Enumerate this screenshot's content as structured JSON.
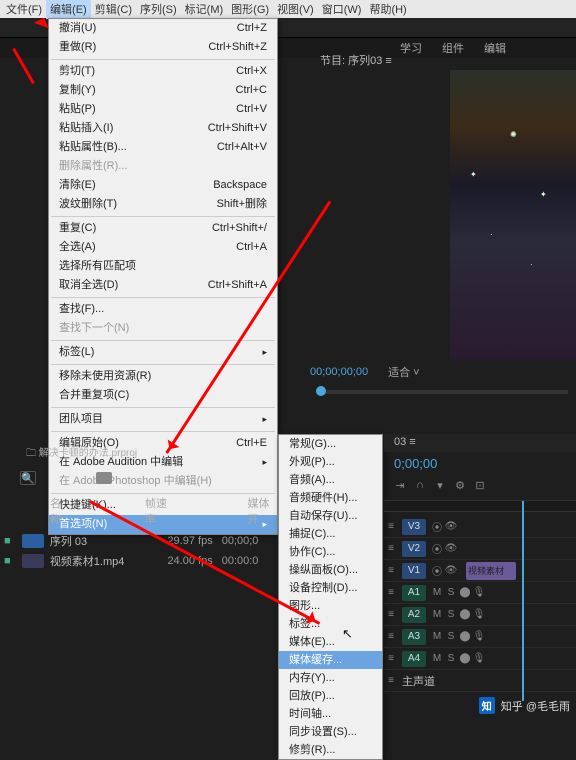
{
  "menubar": [
    "文件(F)",
    "编辑(E)",
    "剪辑(C)",
    "序列(S)",
    "标记(M)",
    "图形(G)",
    "视图(V)",
    "窗口(W)",
    "帮助(H)"
  ],
  "tabs": [
    "学习",
    "组件",
    "编辑"
  ],
  "program_title": "节目: 序列03",
  "edit_menu": [
    {
      "type": "item",
      "label": "撤消(U)",
      "sc": "Ctrl+Z"
    },
    {
      "type": "item",
      "label": "重做(R)",
      "sc": "Ctrl+Shift+Z"
    },
    {
      "type": "sep"
    },
    {
      "type": "item",
      "label": "剪切(T)",
      "sc": "Ctrl+X"
    },
    {
      "type": "item",
      "label": "复制(Y)",
      "sc": "Ctrl+C"
    },
    {
      "type": "item",
      "label": "粘贴(P)",
      "sc": "Ctrl+V"
    },
    {
      "type": "item",
      "label": "粘贴插入(I)",
      "sc": "Ctrl+Shift+V"
    },
    {
      "type": "item",
      "label": "粘贴属性(B)...",
      "sc": "Ctrl+Alt+V"
    },
    {
      "type": "item",
      "label": "删除属性(R)...",
      "sc": "",
      "dis": true
    },
    {
      "type": "item",
      "label": "清除(E)",
      "sc": "Backspace"
    },
    {
      "type": "item",
      "label": "波纹删除(T)",
      "sc": "Shift+删除"
    },
    {
      "type": "sep"
    },
    {
      "type": "item",
      "label": "重复(C)",
      "sc": "Ctrl+Shift+/"
    },
    {
      "type": "item",
      "label": "全选(A)",
      "sc": "Ctrl+A"
    },
    {
      "type": "item",
      "label": "选择所有匹配项",
      "sc": ""
    },
    {
      "type": "item",
      "label": "取消全选(D)",
      "sc": "Ctrl+Shift+A"
    },
    {
      "type": "sep"
    },
    {
      "type": "item",
      "label": "查找(F)...",
      "sc": ""
    },
    {
      "type": "item",
      "label": "查找下一个(N)",
      "sc": "",
      "dis": true
    },
    {
      "type": "sep"
    },
    {
      "type": "item",
      "label": "标签(L)",
      "sc": "",
      "arrow": true
    },
    {
      "type": "sep"
    },
    {
      "type": "item",
      "label": "移除未使用资源(R)",
      "sc": ""
    },
    {
      "type": "item",
      "label": "合并重复项(C)",
      "sc": ""
    },
    {
      "type": "sep"
    },
    {
      "type": "item",
      "label": "团队项目",
      "sc": "",
      "arrow": true
    },
    {
      "type": "sep"
    },
    {
      "type": "item",
      "label": "编辑原始(O)",
      "sc": "Ctrl+E"
    },
    {
      "type": "item",
      "label": "在 Adobe Audition 中编辑",
      "sc": "",
      "arrow": true
    },
    {
      "type": "item",
      "label": "在 Adobe Photoshop 中编辑(H)",
      "sc": "",
      "dis": true
    },
    {
      "type": "sep"
    },
    {
      "type": "item",
      "label": "快捷键(K)...",
      "sc": ""
    },
    {
      "type": "item",
      "label": "首选项(N)",
      "sc": "",
      "arrow": true,
      "hi": true
    }
  ],
  "sub_menu": [
    "常规(G)...",
    "外观(P)...",
    "音频(A)...",
    "音频硬件(H)...",
    "自动保存(U)...",
    "捕捉(C)...",
    "协作(C)...",
    "操纵面板(O)...",
    "设备控制(D)...",
    "图形...",
    "标签...",
    "媒体(E)...",
    "媒体缓存...",
    "内存(Y)...",
    "回放(P)...",
    "时间轴...",
    "同步设置(S)...",
    "修剪(R)..."
  ],
  "sub_menu_hi": 12,
  "playhead": {
    "tc": "00;00;00;00",
    "fit": "适合"
  },
  "project": {
    "file": "解决卡顿的办法.prproj",
    "head": [
      "名称",
      "帧速率",
      "媒体开"
    ],
    "rows": [
      {
        "name": "序列 03",
        "fps": "29.97 fps",
        "start": "00;00;0"
      },
      {
        "name": "视频素材1.mp4",
        "fps": "24.00 fps",
        "start": "00:00:0"
      }
    ]
  },
  "timeline": {
    "seq": "03",
    "tc": "0;00;00",
    "v_tracks": [
      "V3",
      "V2",
      "V1"
    ],
    "a_tracks": [
      "A1",
      "A2",
      "A3",
      "A4"
    ],
    "clip": "视频素材",
    "main_audio": "主声道"
  },
  "watermark": "知乎 @毛毛雨"
}
